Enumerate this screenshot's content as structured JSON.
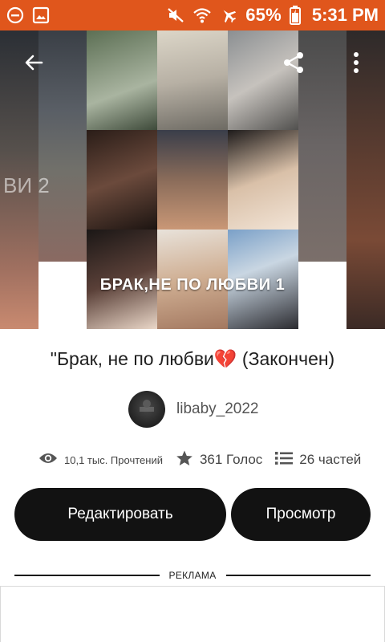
{
  "status_bar": {
    "battery": "65%",
    "time": "5:31 PM",
    "icons_left": [
      "dnd-icon",
      "image-icon"
    ],
    "icons_right": [
      "mute-icon",
      "wifi-icon",
      "airplane-icon",
      "battery-icon"
    ],
    "background_color": "#e0561c"
  },
  "cover": {
    "title_text": "БРАК,НЕ ПО ЛЮБВИ 1",
    "left_neighbor_text": "ВИ 2"
  },
  "top_bar": {
    "back_icon": "arrow-left-icon",
    "share_icon": "share-icon",
    "menu_icon": "more-vertical-icon"
  },
  "story": {
    "title": "\"Брак, не по любви💔 (Закончен)",
    "author": "libaby_2022",
    "reads": "10,1 тыс. Прочтений",
    "votes": "361 Голос",
    "parts": "26 частей"
  },
  "actions": {
    "edit_label": "Редактировать",
    "view_label": "Просмотр"
  },
  "ad": {
    "label": "РЕКЛАМА"
  }
}
